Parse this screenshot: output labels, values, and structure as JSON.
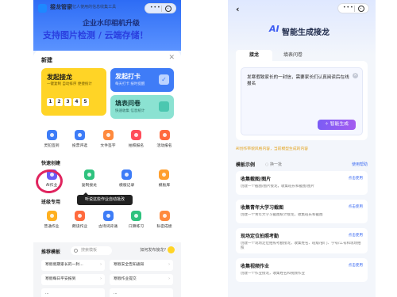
{
  "left": {
    "app_name": "接龙管家",
    "tagline": "5亿人使用的信息收集工具",
    "banner_line1": "企业水印相机升级",
    "banner_line2": "支持图片检测 / 云端存储！",
    "sheet_title": "新建",
    "card_yellow": {
      "title": "发起接龙",
      "subtitle": "一键复制 自动排序 便捷统计",
      "steps": [
        "1",
        "2",
        "3",
        "4",
        "5"
      ]
    },
    "card_blue": {
      "title": "发起打卡",
      "subtitle": "每天打卡 按时提醒",
      "icon": "check-icon"
    },
    "card_teal": {
      "title": "填表问卷",
      "subtitle": "快速收集 信息统计"
    },
    "row1": [
      "灵犯签到",
      "投票评选",
      "文件签字",
      "拍照报名",
      "活动报名"
    ],
    "row1_colors": [
      "#3d7cf7",
      "#3d7cf7",
      "#ff8a3d",
      "#ff4d5a",
      "#ff6a3d"
    ],
    "quick_title": "快速创建",
    "row2": [
      "AI作业",
      "复制接龙",
      "模版记录",
      "模板库"
    ],
    "row2_colors": [
      "#6a5cf5",
      "#2ec27e",
      "#3d7cf7",
      "#ff9f2e"
    ],
    "tooltip": "听说这些作业自动批改",
    "class_title": "班级专用",
    "row3": [
      "普通作业",
      "朗读作业",
      "古诗词背诵",
      "口算练习",
      "私密成绩"
    ],
    "row3_colors": [
      "#ffb020",
      "#ff6a3d",
      "#3d7cf7",
      "#2ec27e",
      "#ff8a3d"
    ],
    "rec_title": "推荐模板",
    "rec_search": "搜索模板",
    "rec_help": "如何发布接龙?",
    "rec_items": [
      "寒假假期家长的一封...",
      "寒假安全告知通知",
      "寒假每日平安报到",
      "寒假作业提交",
      "...",
      "..."
    ]
  },
  "right": {
    "title": "智能生成接龙",
    "ai_badge": "AI",
    "tab_active": "接龙",
    "tab_other": "填表问卷",
    "input_text": "发寒假致家长的一封信，需要家长们认真阅读后在线报名",
    "clear_label": "×",
    "gen_button": "✧ 智能生成",
    "hint": "AI创作带貌风格内容，当前模型生成的内容",
    "examples_title": "模板示例",
    "refresh": "◌ 换一批",
    "help": "使用帮助",
    "use_label": "点击使用",
    "examples": [
      {
        "title": "收集截图/图片",
        "desc": "创建一个截图/图片接龙，收集班长和截图/图片"
      },
      {
        "title": "收集青年大学习截图",
        "desc": "创建一个青年大学习截图统计接龙，收集班长和截图"
      },
      {
        "title": "现场定位拍照考勤",
        "desc": "创建一个现场定位拍照考勤接龙，收集姓名、班级/部门、学号/工号和现场拍照"
      },
      {
        "title": "收集视频作业",
        "desc": "创建一个作业接龙，收集姓名和视频作业"
      }
    ]
  }
}
